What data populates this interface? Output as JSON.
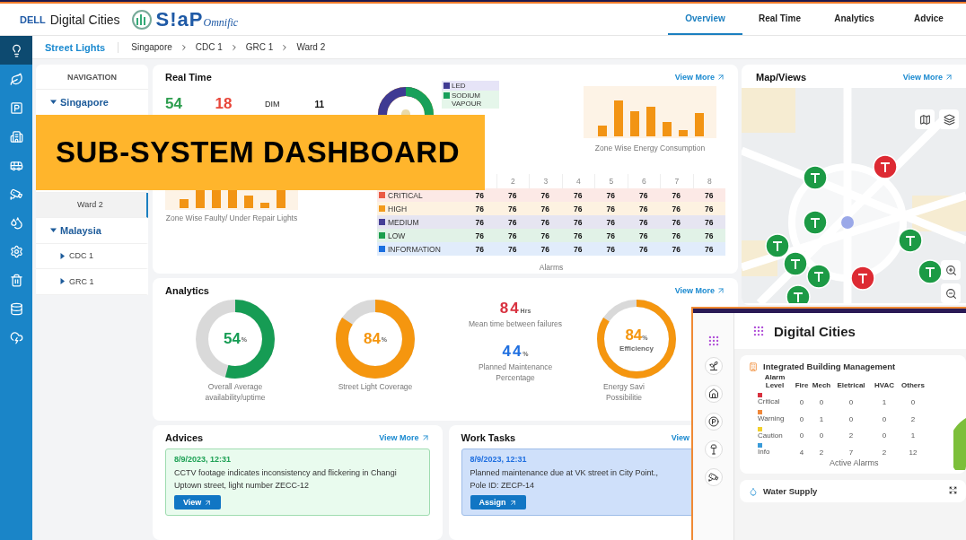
{
  "header": {
    "brand": "DELL",
    "product": "Digital Cities",
    "logo_text": "S!aP",
    "logo_suffix": "Omnific",
    "tabs": [
      {
        "label": "Overview",
        "selected": true
      },
      {
        "label": "Real Time",
        "selected": false
      },
      {
        "label": "Analytics",
        "selected": false
      },
      {
        "label": "Advice",
        "selected": false
      }
    ]
  },
  "sidebar": {
    "items": [
      {
        "kind": "lamp",
        "selected": true
      },
      {
        "kind": "leaf",
        "selected": false
      },
      {
        "kind": "parking",
        "selected": false
      },
      {
        "kind": "building",
        "selected": false
      },
      {
        "kind": "bus",
        "selected": false
      },
      {
        "kind": "cctv",
        "selected": false
      },
      {
        "kind": "water",
        "selected": false
      },
      {
        "kind": "gear",
        "selected": false
      },
      {
        "kind": "bin",
        "selected": false
      },
      {
        "kind": "database",
        "selected": false
      },
      {
        "kind": "cloud",
        "selected": false
      }
    ]
  },
  "breadcrumb": {
    "section": "Street Lights",
    "path": [
      "Singapore",
      "CDC 1",
      "GRC 1",
      "Ward 2"
    ]
  },
  "navigation": {
    "title": "NAVIGATION",
    "items": [
      {
        "label": "Singapore",
        "expanded": true,
        "selected": false,
        "children": [
          {
            "children": [
              {
                "children": [
                  {
                    "label": "Ward 2",
                    "selected": true
                  }
                ]
              }
            ]
          }
        ]
      },
      {
        "label": "Malaysia",
        "expanded": true,
        "selected": false,
        "children": [
          {
            "label": "CDC 1",
            "expanded": false,
            "selected": false
          },
          {
            "label": "GRC 1",
            "expanded": false,
            "selected": false
          }
        ]
      }
    ]
  },
  "real_time": {
    "title": "Real Time",
    "view_more": "View More",
    "stats": [
      {
        "value": "54",
        "color": "#2e9e4f"
      },
      {
        "value": "18",
        "color": "#e8463a"
      }
    ],
    "dim": {
      "label": "DIM",
      "value": "11"
    },
    "faulty_caption": "Zone Wise Faulty/ Under Repair Lights",
    "light_types": [
      {
        "label": "LED",
        "color": "#3f3a93"
      },
      {
        "label": "SODIUM VAPOUR",
        "color": "#18a05a"
      }
    ],
    "energy_caption": "Zone Wise Energy Consumption",
    "alarms": {
      "zones": [
        "2",
        "3",
        "4",
        "5",
        "6",
        "7",
        "8"
      ],
      "caption": "Alarms",
      "rows": [
        {
          "label": "CRITICAL",
          "color": "#ea5a45",
          "values": [
            "76",
            "76",
            "76",
            "76",
            "76",
            "76",
            "76",
            "76"
          ]
        },
        {
          "label": "HIGH",
          "color": "#f29b1d",
          "values": [
            "76",
            "76",
            "76",
            "76",
            "76",
            "76",
            "76",
            "76"
          ]
        },
        {
          "label": "MEDIUM",
          "color": "#463f97",
          "values": [
            "76",
            "76",
            "76",
            "76",
            "76",
            "76",
            "76",
            "76"
          ]
        },
        {
          "label": "LOW",
          "color": "#1c9e4d",
          "values": [
            "76",
            "76",
            "76",
            "76",
            "76",
            "76",
            "76",
            "76"
          ]
        },
        {
          "label": "INFORMATION",
          "color": "#1b6fe0",
          "values": [
            "76",
            "76",
            "76",
            "76",
            "76",
            "76",
            "76",
            "76"
          ]
        }
      ]
    }
  },
  "map": {
    "title": "Map/Views",
    "view_more": "View More"
  },
  "analytics": {
    "title": "Analytics",
    "view_more": "View More",
    "gauges": [
      {
        "value": "54",
        "unit": "%",
        "level": 0.54,
        "color": "#169c54",
        "caption": "Overall Average availability/uptime"
      },
      {
        "value": "84",
        "unit": "%",
        "level": 0.84,
        "color": "#f5960f",
        "caption": "Street Light Coverage"
      }
    ],
    "stats": [
      {
        "value": "84",
        "unit": "Hrs",
        "caption": "Mean time between failures",
        "color": "#d8313f"
      },
      {
        "value": "44",
        "unit": "%",
        "caption": "Planned Maintenance Percentage",
        "color": "#1f6fe0"
      }
    ],
    "efficiency": {
      "value": "84",
      "unit": "%",
      "label": "Efficiency",
      "level": 0.84,
      "caption": "Energy Savi Possibilitie"
    }
  },
  "advices": {
    "title": "Advices",
    "view_more": "View More",
    "items": [
      {
        "time": "8/9/2023, 12:31",
        "text": "CCTV footage indicates inconsistency and flickering in Changi Uptown street, light number ZECC-12",
        "action": "View"
      }
    ]
  },
  "work_tasks": {
    "title": "Work Tasks",
    "view_more": "View",
    "items": [
      {
        "time": "8/9/2023, 12:31",
        "text": "Planned maintenance due at VK street in City Point., Pole ID: ZECP-14",
        "action": "Assign"
      }
    ]
  },
  "banner": {
    "title": "SUB-SYSTEM DASHBOARD"
  },
  "inset": {
    "title": "Digital Cities",
    "building": {
      "title": "Integrated Building Management",
      "level_header": "Alarm Level",
      "columns": [
        "Fire",
        "Mech",
        "Eletrical",
        "HVAC",
        "Others"
      ],
      "rows": [
        {
          "label": "Critical",
          "color": "#d8313f",
          "values": [
            "0",
            "0",
            "0",
            "1",
            "0"
          ]
        },
        {
          "label": "Warning",
          "color": "#f0883a",
          "values": [
            "0",
            "1",
            "0",
            "0",
            "2"
          ]
        },
        {
          "label": "Caution",
          "color": "#f2d02b",
          "values": [
            "0",
            "0",
            "2",
            "0",
            "1"
          ]
        },
        {
          "label": "Info",
          "color": "#3a9bd9",
          "values": [
            "4",
            "2",
            "7",
            "2",
            "12"
          ]
        }
      ],
      "caption": "Active Alarms"
    },
    "water": {
      "title": "Water Supply"
    }
  }
}
